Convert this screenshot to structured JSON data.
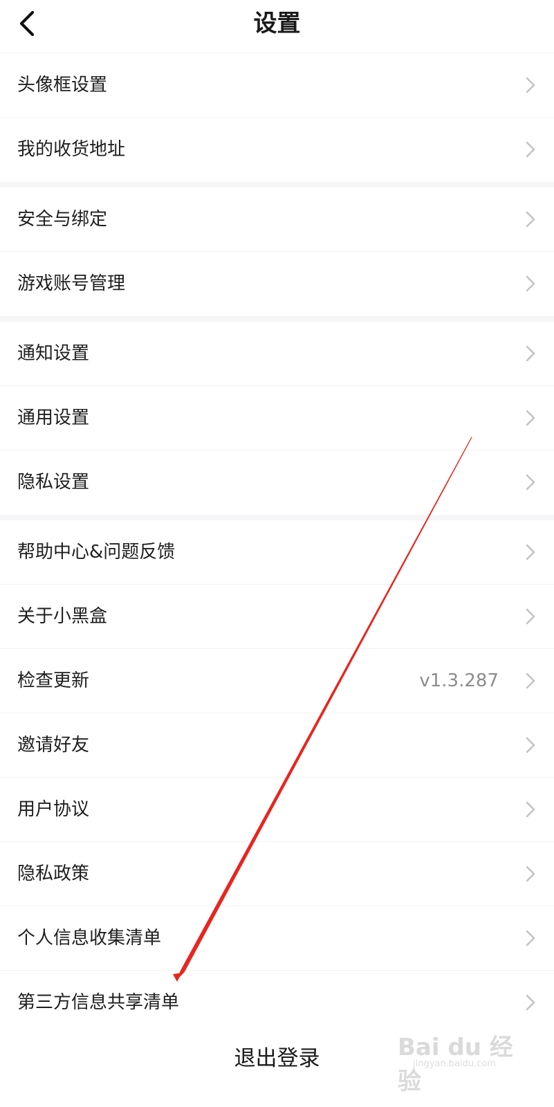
{
  "header": {
    "title": "设置"
  },
  "groups": [
    [
      {
        "label": "头像框设置",
        "value": ""
      },
      {
        "label": "我的收货地址",
        "value": ""
      }
    ],
    [
      {
        "label": "安全与绑定",
        "value": ""
      },
      {
        "label": "游戏账号管理",
        "value": ""
      }
    ],
    [
      {
        "label": "通知设置",
        "value": ""
      },
      {
        "label": "通用设置",
        "value": ""
      },
      {
        "label": "隐私设置",
        "value": ""
      }
    ],
    [
      {
        "label": "帮助中心&问题反馈",
        "value": ""
      },
      {
        "label": "关于小黑盒",
        "value": ""
      },
      {
        "label": "检查更新",
        "value": "v1.3.287"
      },
      {
        "label": "邀请好友",
        "value": ""
      },
      {
        "label": "用户协议",
        "value": ""
      },
      {
        "label": "隐私政策",
        "value": ""
      },
      {
        "label": "个人信息收集清单",
        "value": ""
      },
      {
        "label": "第三方信息共享清单",
        "value": ""
      }
    ]
  ],
  "logout_label": "退出登录",
  "watermark": {
    "text": "Bai du 经验",
    "url": "jingyan.baidu.com"
  },
  "colors": {
    "annotation_arrow": "#e8261f",
    "chevron": "#c4c4c4",
    "divider": "#f2f2f2"
  },
  "icons": {
    "back": "chevron-left-icon",
    "row_arrow": "chevron-right-icon"
  }
}
